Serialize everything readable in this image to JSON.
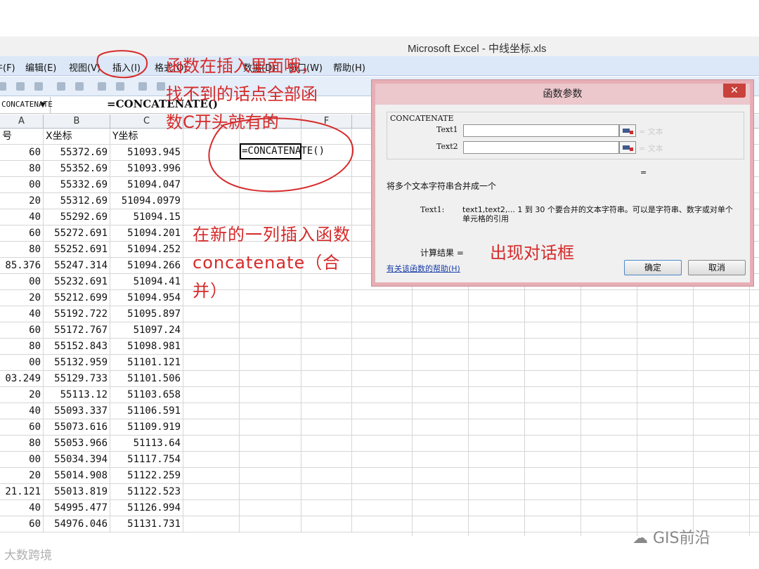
{
  "window": {
    "title": "Microsoft Excel - 中线坐标.xls"
  },
  "menubar": [
    {
      "label": "文件(F)"
    },
    {
      "label": "编辑(E)"
    },
    {
      "label": "视图(V)"
    },
    {
      "label": "插入(I)"
    },
    {
      "label": "格式(O)"
    },
    {
      "label": "数据(D)"
    },
    {
      "label": "窗口(W)"
    },
    {
      "label": "帮助(H)"
    }
  ],
  "formula_bar": {
    "name_box": "CONCATENATE",
    "formula": "=CONCATENATE()"
  },
  "columns": [
    "A",
    "B",
    "C",
    "D",
    "E",
    "F"
  ],
  "headers": {
    "a": "号",
    "b": "X坐标",
    "c": "Y坐标"
  },
  "rows": [
    {
      "a": "60",
      "b": "55372.69",
      "c": "51093.945"
    },
    {
      "a": "80",
      "b": "55352.69",
      "c": "51093.996"
    },
    {
      "a": "00",
      "b": "55332.69",
      "c": "51094.047"
    },
    {
      "a": "20",
      "b": "55312.69",
      "c": "51094.0979"
    },
    {
      "a": "40",
      "b": "55292.69",
      "c": "51094.15"
    },
    {
      "a": "60",
      "b": "55272.691",
      "c": "51094.201"
    },
    {
      "a": "80",
      "b": "55252.691",
      "c": "51094.252"
    },
    {
      "a": "85.376",
      "b": "55247.314",
      "c": "51094.266"
    },
    {
      "a": "00",
      "b": "55232.691",
      "c": "51094.41"
    },
    {
      "a": "20",
      "b": "55212.699",
      "c": "51094.954"
    },
    {
      "a": "40",
      "b": "55192.722",
      "c": "51095.897"
    },
    {
      "a": "60",
      "b": "55172.767",
      "c": "51097.24"
    },
    {
      "a": "80",
      "b": "55152.843",
      "c": "51098.981"
    },
    {
      "a": "00",
      "b": "55132.959",
      "c": "51101.121"
    },
    {
      "a": "03.249",
      "b": "55129.733",
      "c": "51101.506"
    },
    {
      "a": "20",
      "b": "55113.12",
      "c": "51103.658"
    },
    {
      "a": "40",
      "b": "55093.337",
      "c": "51106.591"
    },
    {
      "a": "60",
      "b": "55073.616",
      "c": "51109.919"
    },
    {
      "a": "80",
      "b": "55053.966",
      "c": "51113.64"
    },
    {
      "a": "00",
      "b": "55034.394",
      "c": "51117.754"
    },
    {
      "a": "20",
      "b": "55014.908",
      "c": "51122.259"
    },
    {
      "a": "21.121",
      "b": "55013.819",
      "c": "51122.523"
    },
    {
      "a": "40",
      "b": "54995.477",
      "c": "51126.994"
    },
    {
      "a": "60",
      "b": "54976.046",
      "c": "51131.731"
    }
  ],
  "active_cell": {
    "value": "=CONCATENATE()"
  },
  "dialog": {
    "title": "函数参数",
    "close": "✕",
    "function_name": "CONCATENATE",
    "args": [
      {
        "label": "Text1",
        "value": "",
        "ghost": "= 文本"
      },
      {
        "label": "Text2",
        "value": "",
        "ghost": "= 文本"
      }
    ],
    "equals": "=",
    "description": "将多个文本字符串合并成一个",
    "arg_desc_label": "Text1:",
    "arg_desc": "text1,text2,... 1 到 30 个要合并的文本字符串。可以是字符串、数字或对单个单元格的引用",
    "result_label": "计算结果 =",
    "help_link": "有关该函数的帮助(H)",
    "ok": "确定",
    "cancel": "取消"
  },
  "annotations": {
    "line1": "函数在插入里面哦，",
    "line2": "找不到的话点全部函",
    "line3": "数C开头就有的",
    "mid1": "在新的一列插入函数",
    "mid2": "concatenate（合",
    "mid3": "并）",
    "dialog_note": "出现对话框"
  },
  "watermarks": {
    "right": "GIS前沿",
    "left": "大数跨境"
  },
  "colors": {
    "annotation": "#d62a2a",
    "menubar": "#dce8f7",
    "dialog_border": "#e7aeb5"
  }
}
